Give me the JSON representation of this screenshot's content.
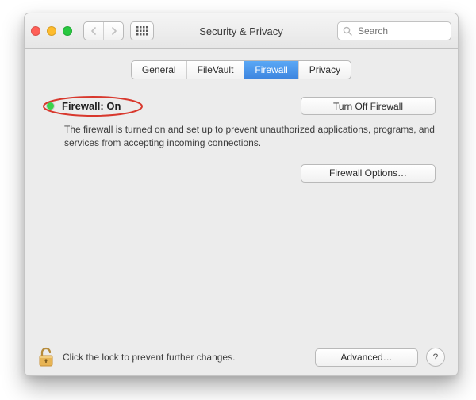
{
  "window": {
    "title": "Security & Privacy"
  },
  "toolbar": {
    "search_placeholder": "Search"
  },
  "tabs": [
    {
      "label": "General"
    },
    {
      "label": "FileVault"
    },
    {
      "label": "Firewall",
      "active": true
    },
    {
      "label": "Privacy"
    }
  ],
  "firewall": {
    "status_label": "Firewall: On",
    "indicator_color": "#3bd24a",
    "turn_off_label": "Turn Off Firewall",
    "description": "The firewall is turned on and set up to prevent unauthorized applications, programs, and services from accepting incoming connections.",
    "options_label": "Firewall Options…"
  },
  "footer": {
    "lock_hint": "Click the lock to prevent further changes.",
    "advanced_label": "Advanced…",
    "help_label": "?"
  },
  "annotation": {
    "callout_ellipse": true,
    "callout_color": "#d8382d"
  }
}
